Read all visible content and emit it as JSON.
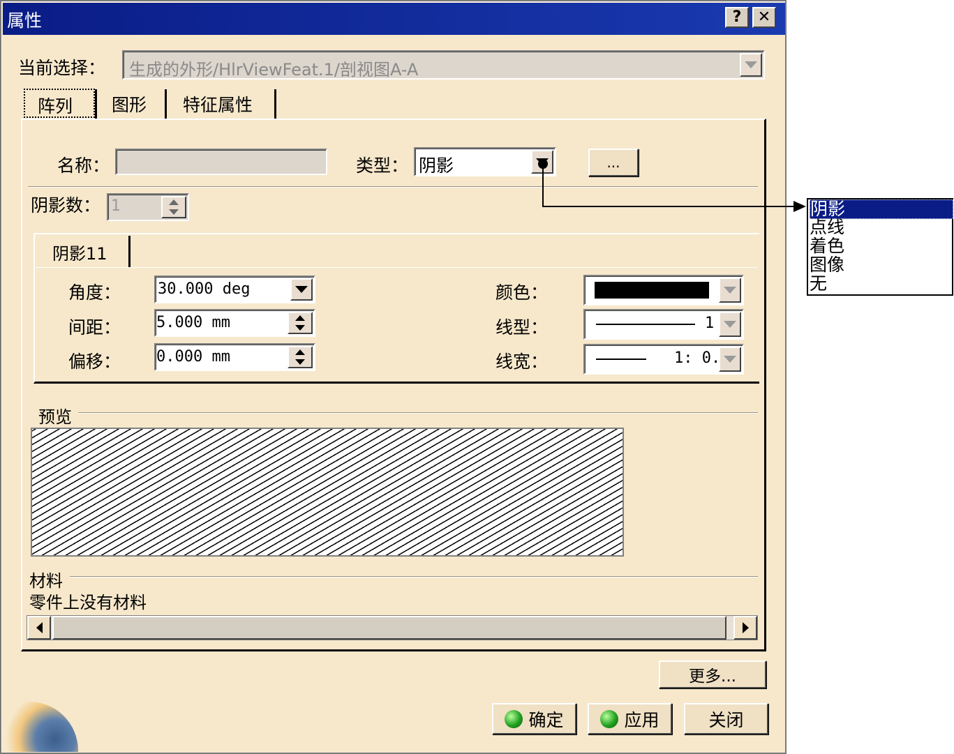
{
  "window": {
    "title": "属性",
    "help_label": "?",
    "close_label": "✕"
  },
  "current_selection": {
    "label": "当前选择：",
    "value": "生成的外形/HlrViewFeat.1/剖视图A-A"
  },
  "tabs": [
    {
      "label": "阵列",
      "active": true
    },
    {
      "label": "图形",
      "active": false
    },
    {
      "label": "特征属性",
      "active": false
    }
  ],
  "pattern": {
    "name_label": "名称：",
    "name_value": "",
    "type_label": "类型：",
    "type_value": "阴影",
    "ellipsis_label": "...",
    "hatch_count_label": "阴影数：",
    "hatch_count_value": "1",
    "subtab_label": "阴影11",
    "angle_label": "角度：",
    "angle_value": "30.000 deg",
    "spacing_label": "间距：",
    "spacing_value": "5.000 mm",
    "offset_label": "偏移：",
    "offset_value": "0.000 mm",
    "color_label": "颜色：",
    "color_value_hex": "#000000",
    "linetype_label": "线型：",
    "linetype_value": "1",
    "linewidth_label": "线宽：",
    "linewidth_value": "1: 0."
  },
  "preview": {
    "label": "预览"
  },
  "material": {
    "label": "材料",
    "value": "零件上没有材料"
  },
  "buttons": {
    "more": "更多...",
    "ok": "确定",
    "apply": "应用",
    "close": "关闭"
  },
  "type_popup": {
    "items": [
      "阴影",
      "点线",
      "着色",
      "图像",
      "无"
    ],
    "selected": "阴影"
  },
  "colors": {
    "dialog_bg": "#f7e8cc",
    "title_bar": "#0a1c86",
    "selection": "#0a1c86"
  }
}
